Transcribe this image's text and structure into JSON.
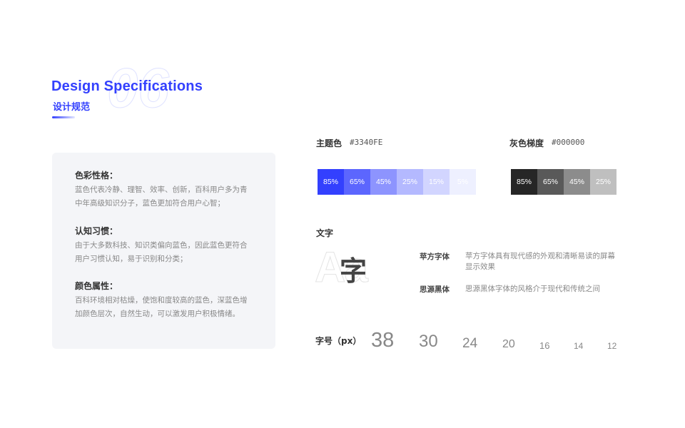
{
  "header": {
    "title": "Design Specifications",
    "subtitle": "设计规范",
    "bg_number": "06"
  },
  "card": {
    "sections": [
      {
        "heading": "色彩性格：",
        "body": "蓝色代表冷静、理智、效率、创新，百科用户多为青中年高级知识分子，蓝色更加符合用户心智；"
      },
      {
        "heading": "认知习惯：",
        "body": "由于大多数科技、知识类偏向蓝色，因此蓝色更符合用户习惯认知，易于识别和分类；"
      },
      {
        "heading": "颜色属性：",
        "body": "百科环境相对枯燥，使饱和度较高的蓝色，深蓝色增加颜色层次，自然生动，可以激发用户积极情绪。"
      }
    ]
  },
  "main_color": {
    "label": "主题色",
    "code": "#3340FE",
    "swatches": [
      {
        "label": "85%",
        "color": "#3340FE"
      },
      {
        "label": "65%",
        "color": "#5C66FE"
      },
      {
        "label": "45%",
        "color": "#8D94FE"
      },
      {
        "label": "25%",
        "color": "#B4B9FF"
      },
      {
        "label": "15%",
        "color": "#D2D5FF"
      },
      {
        "label": "5%",
        "color": "#EEF0FF"
      }
    ]
  },
  "gray_color": {
    "label": "灰色梯度",
    "code": "#000000",
    "swatches": [
      {
        "label": "85%",
        "color": "#262626"
      },
      {
        "label": "65%",
        "color": "#595959"
      },
      {
        "label": "45%",
        "color": "#8C8C8C"
      },
      {
        "label": "25%",
        "color": "#BFBFBF"
      }
    ]
  },
  "typography": {
    "label": "文字",
    "ghost_text": "Aa",
    "sample_char": "字",
    "fonts": [
      {
        "name": "苹方字体",
        "desc": "苹方字体具有现代感的外观和清晰易读的屏幕显示效果"
      },
      {
        "name": "思源黑体",
        "desc": "思源黑体字体的风格介于现代和传统之间"
      }
    ]
  },
  "font_sizes": {
    "label": "字号（px）",
    "sizes": [
      "38",
      "30",
      "24",
      "20",
      "16",
      "14",
      "12"
    ]
  }
}
